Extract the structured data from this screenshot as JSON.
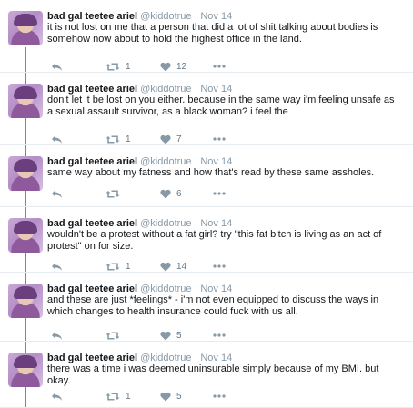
{
  "tweets": [
    {
      "name": "bad gal teetee ariel",
      "handle": "@kiddotrue",
      "sep": "·",
      "date": "Nov 14",
      "text": "it is not lost on me that a person that did a lot of shit talking about bodies is somehow now about to hold the highest office in the land.",
      "retweets": "1",
      "likes": "12"
    },
    {
      "name": "bad gal teetee ariel",
      "handle": "@kiddotrue",
      "sep": "·",
      "date": "Nov 14",
      "text": "don't let it be lost on you either. because in the same way i'm feeling unsafe as a sexual assault survivor, as a black woman? i feel the",
      "retweets": "1",
      "likes": "7"
    },
    {
      "name": "bad gal teetee ariel",
      "handle": "@kiddotrue",
      "sep": "·",
      "date": "Nov 14",
      "text": "same way about my fatness and how that's read by these same assholes.",
      "retweets": "",
      "likes": "6"
    },
    {
      "name": "bad gal teetee ariel",
      "handle": "@kiddotrue",
      "sep": "·",
      "date": "Nov 14",
      "text": "wouldn't be a protest without a fat girl? try \"this fat bitch is living as an act of protest\" on for size.",
      "retweets": "1",
      "likes": "14"
    },
    {
      "name": "bad gal teetee ariel",
      "handle": "@kiddotrue",
      "sep": "·",
      "date": "Nov 14",
      "text": "and these are just *feelings* - i'm not even equipped to discuss the ways in which changes to health insurance could fuck with us all.",
      "retweets": "",
      "likes": "5"
    },
    {
      "name": "bad gal teetee ariel",
      "handle": "@kiddotrue",
      "sep": "·",
      "date": "Nov 14",
      "text": "there was a time i was deemed uninsurable simply because of my BMI. but okay.",
      "retweets": "1",
      "likes": "5"
    }
  ],
  "icons": {
    "reply": "reply-icon",
    "retweet": "retweet-icon",
    "like": "heart-icon",
    "more": "more-icon"
  },
  "colors": {
    "thread_line": "#a06ac7",
    "muted": "#8899a6"
  }
}
